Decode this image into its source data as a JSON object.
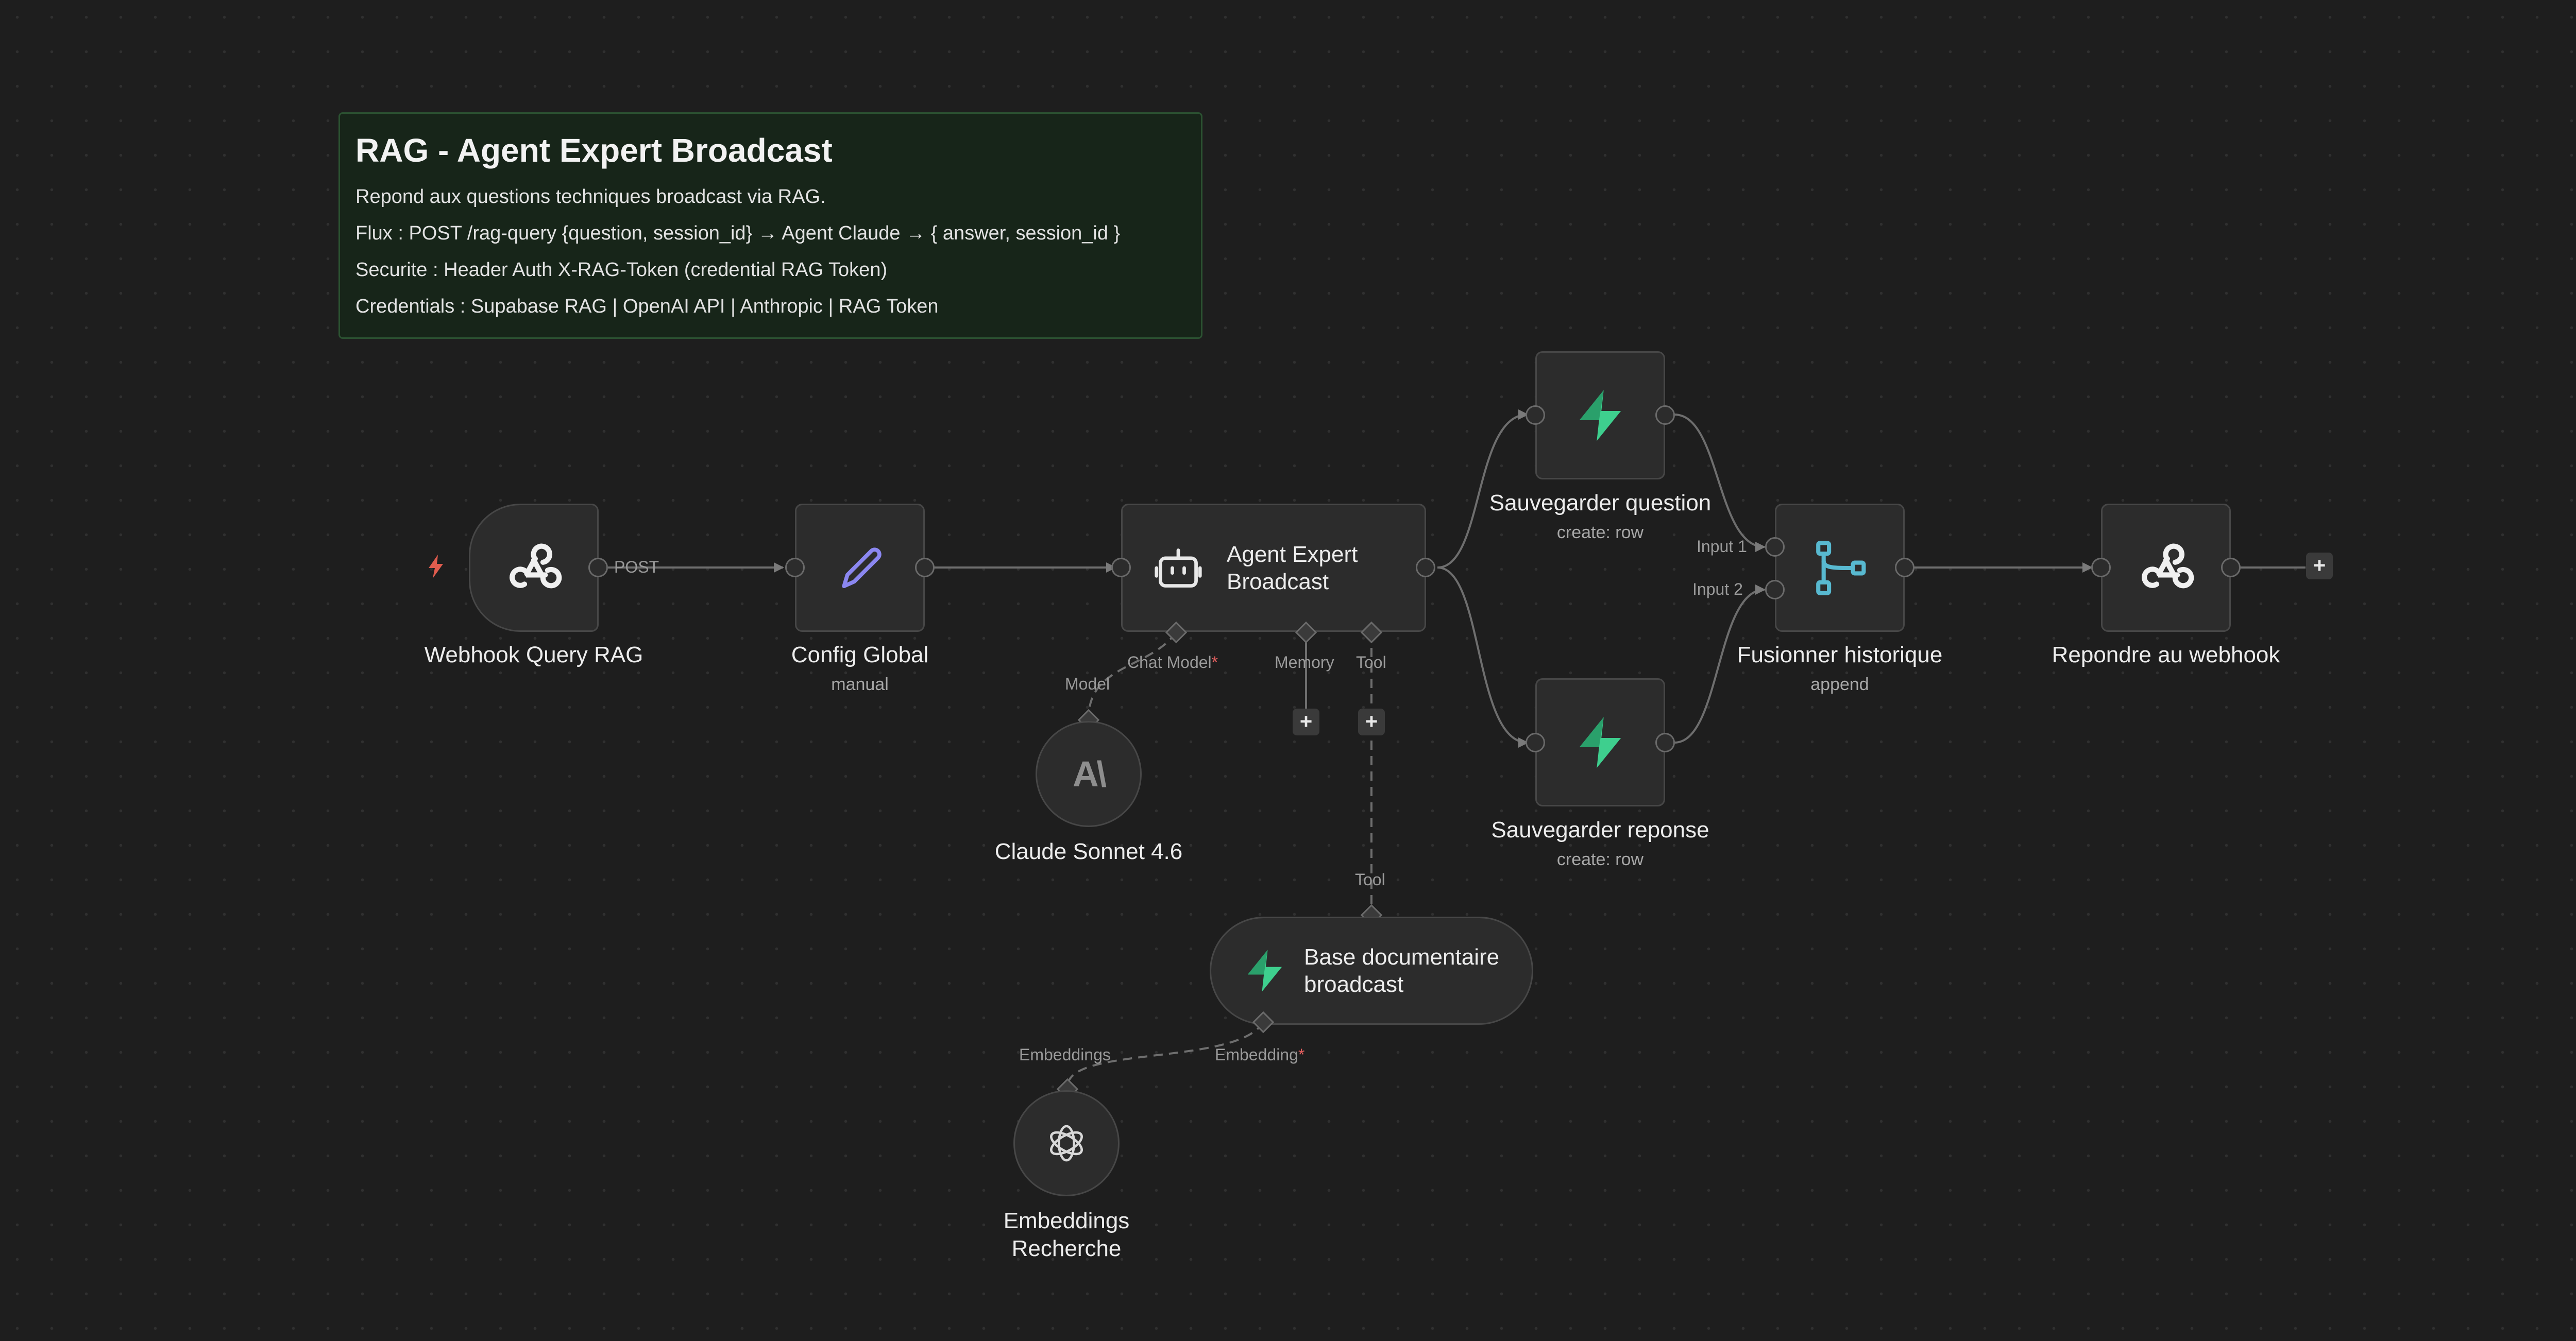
{
  "sticky": {
    "title": "RAG - Agent Expert Broadcast",
    "lines": [
      "Repond aux questions techniques broadcast via RAG.",
      "Flux : POST /rag-query {question, session_id} → Agent Claude → { answer, session_id }",
      "Securite : Header Auth X-RAG-Token (credential RAG Token)",
      "Credentials : Supabase RAG | OpenAI API | Anthropic | RAG Token"
    ]
  },
  "nodes": {
    "webhook": {
      "name": "Webhook Query RAG",
      "icon": "webhook-icon",
      "trigger_icon": "lightning-icon"
    },
    "config": {
      "name": "Config Global",
      "sub": "manual",
      "icon": "pencil-icon"
    },
    "agent": {
      "name": "Agent Expert Broadcast",
      "line1": "Agent Expert",
      "line2": "Broadcast",
      "icon": "robot-icon"
    },
    "save_q": {
      "name": "Sauvegarder question",
      "sub": "create: row",
      "icon": "supabase-icon"
    },
    "save_r": {
      "name": "Sauvegarder reponse",
      "sub": "create: row",
      "icon": "supabase-icon"
    },
    "merge": {
      "name": "Fusionner historique",
      "sub": "append",
      "icon": "merge-icon"
    },
    "respond": {
      "name": "Repondre au webhook",
      "icon": "webhook-icon"
    },
    "claude": {
      "name": "Claude Sonnet 4.6",
      "icon": "anthropic-icon",
      "logo_text": "A\\"
    },
    "docs": {
      "name": "Base documentaire broadcast",
      "line1": "Base documentaire",
      "line2": "broadcast",
      "icon": "supabase-icon"
    },
    "embed": {
      "name": "Embeddings Recherche",
      "line1": "Embeddings",
      "line2": "Recherche",
      "icon": "openai-icon"
    }
  },
  "ports": {
    "post": "POST",
    "chat_model": "Chat Model",
    "memory": "Memory",
    "tool": "Tool",
    "model": "Model",
    "tool_out": "Tool",
    "embeddings": "Embeddings",
    "embedding": "Embedding",
    "input1": "Input 1",
    "input2": "Input 2",
    "required_mark": "*"
  },
  "buttons": {
    "add": "+",
    "add_end": "+"
  },
  "colors": {
    "canvas": "#1e1e1e",
    "node_bg": "#2c2c2c",
    "supabase_green": "#3ecf8e",
    "merge_teal": "#58b9d0",
    "pencil_purple": "#8b87f0",
    "trigger_red": "#e05c4e",
    "sticky_bg": "#172519"
  }
}
